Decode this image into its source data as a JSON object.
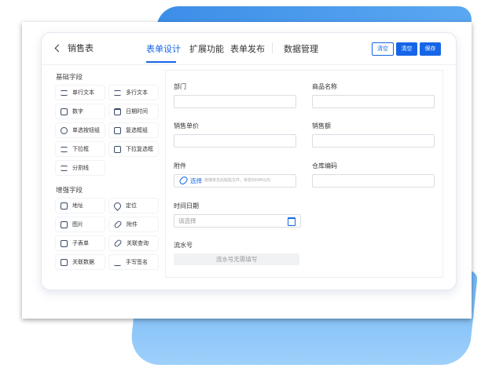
{
  "header": {
    "back_label": "销售表",
    "tabs": [
      "表单设计",
      "扩展功能",
      "表单发布",
      "数据管理"
    ],
    "buttons": {
      "clear_outline": "清空",
      "clear_solid": "清空",
      "save": "保存"
    }
  },
  "palette": {
    "basic_title": "基础字段",
    "basic": [
      "单行文本",
      "多行文本",
      "数字",
      "日期时间",
      "单选按钮组",
      "复选框组",
      "下拉框",
      "下拉复选框",
      "分割线"
    ],
    "enhanced_title": "增强字段",
    "enhanced": [
      "地址",
      "定位",
      "图片",
      "附件",
      "子表单",
      "关联查询",
      "关联数据",
      "手写签名"
    ]
  },
  "form": {
    "dept_label": "部门",
    "product_label": "商品名称",
    "price_label": "销售单价",
    "amount_label": "销售额",
    "attach_label": "附件",
    "attach_select": "选择",
    "attach_hint": "拖拽单击后粘贴文件，单张500M以内",
    "warehouse_label": "仓库编码",
    "datetime_label": "时间日期",
    "datetime_placeholder": "请选择",
    "serial_label": "流水号",
    "serial_placeholder": "流水号无需填写"
  },
  "colors": {
    "accent": "#1565e8"
  }
}
